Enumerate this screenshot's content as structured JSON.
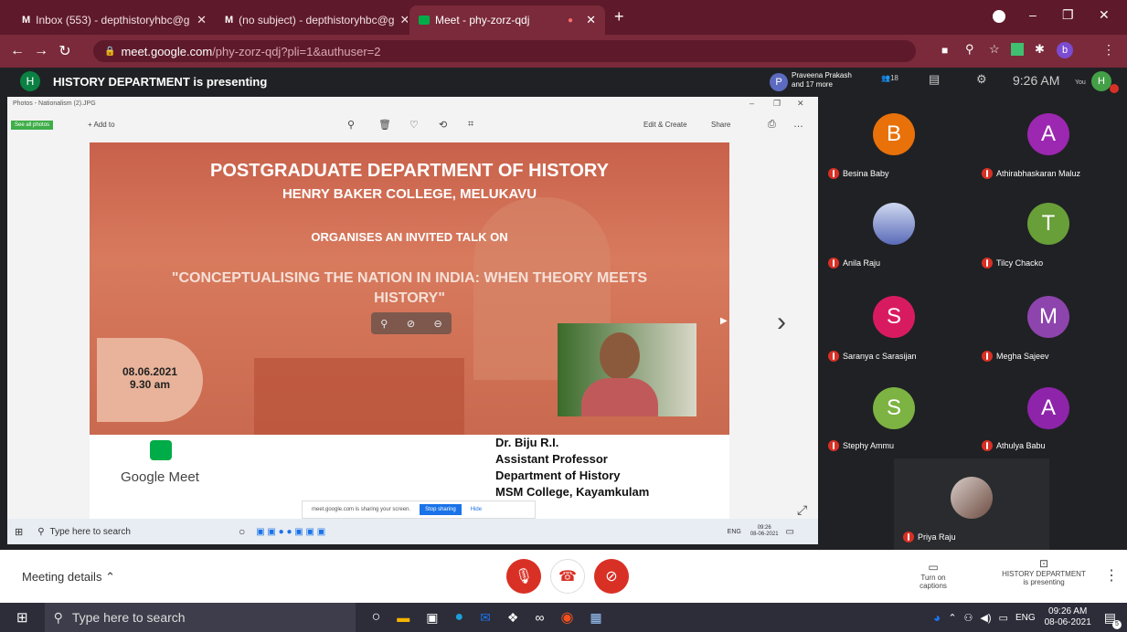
{
  "browser": {
    "tabs": [
      {
        "label": "Inbox (553) - depthistoryhbc@g",
        "active": false
      },
      {
        "label": "(no subject) - depthistoryhbc@g",
        "active": false
      },
      {
        "label": "Meet - phy-zorz-qdj",
        "active": true
      }
    ],
    "new_tab": "+",
    "url_host": "meet.google.com",
    "url_path": "/phy-zorz-qdj?pli=1&authuser=2",
    "profile_initial": "b"
  },
  "meet": {
    "presenter_initial": "H",
    "presenter_text": "HISTORY DEPARTMENT is presenting",
    "header_avatar": "P",
    "header_people": "Praveena Prakash and 17 more",
    "time": "9:26 AM",
    "you_initial": "H",
    "you_label": "You",
    "participant_count": "18"
  },
  "photos": {
    "title": "Photos - Nationalism (2).JPG",
    "see_all": "See all photos",
    "add_to": "+ Add to",
    "edit_create": "Edit & Create",
    "share": "Share"
  },
  "slide": {
    "line1": "POSTGRADUATE DEPARTMENT OF HISTORY",
    "line2": "HENRY BAKER COLLEGE, MELUKAVU",
    "line3": "ORGANISES AN INVITED TALK ON",
    "line4": "\"CONCEPTUALISING THE NATION IN INDIA: WHEN THEORY MEETS",
    "line5": "HISTORY\"",
    "date": "08.06.2021",
    "time": "9.30 am",
    "speaker_name": "Dr. Biju R.I.",
    "speaker_title": "Assistant Professor",
    "speaker_dept": "Department of History",
    "speaker_college": "MSM College, Kayamkulam",
    "meet_logo_text": "Google Meet"
  },
  "sharebar": {
    "text": "meet.google.com is sharing your screen.",
    "stop": "Stop sharing",
    "hide": "Hide"
  },
  "inner_taskbar": {
    "search": "Type here to search",
    "time": "09:26",
    "date": "08-06-2021",
    "lang": "ENG"
  },
  "participants": [
    {
      "initial": "B",
      "name": "Besina Baby",
      "color": "#e8710a"
    },
    {
      "initial": "A",
      "name": "Athirabhaskaran Maluz",
      "color": "#9c27b0"
    },
    {
      "initial": "",
      "name": "Anila Raju",
      "color": "#7986cb"
    },
    {
      "initial": "T",
      "name": "Tilcy Chacko",
      "color": "#689f38"
    },
    {
      "initial": "S",
      "name": "Saranya c Sarasijan",
      "color": "#d81b60"
    },
    {
      "initial": "M",
      "name": "Megha Sajeev",
      "color": "#8e44ad"
    },
    {
      "initial": "S",
      "name": "Stephy Ammu",
      "color": "#7cb342"
    },
    {
      "initial": "A",
      "name": "Athulya Babu",
      "color": "#8e24aa"
    },
    {
      "initial": "",
      "name": "Priya Raju",
      "color": "#a1887f"
    }
  ],
  "bottom": {
    "meeting_details": "Meeting details",
    "captions": "Turn on captions",
    "presenting_1": "HISTORY DEPARTMENT",
    "presenting_2": "is presenting"
  },
  "win_taskbar": {
    "search": "Type here to search",
    "time": "09:26 AM",
    "date": "08-06-2021",
    "lang": "ENG",
    "notif_count": "5"
  }
}
